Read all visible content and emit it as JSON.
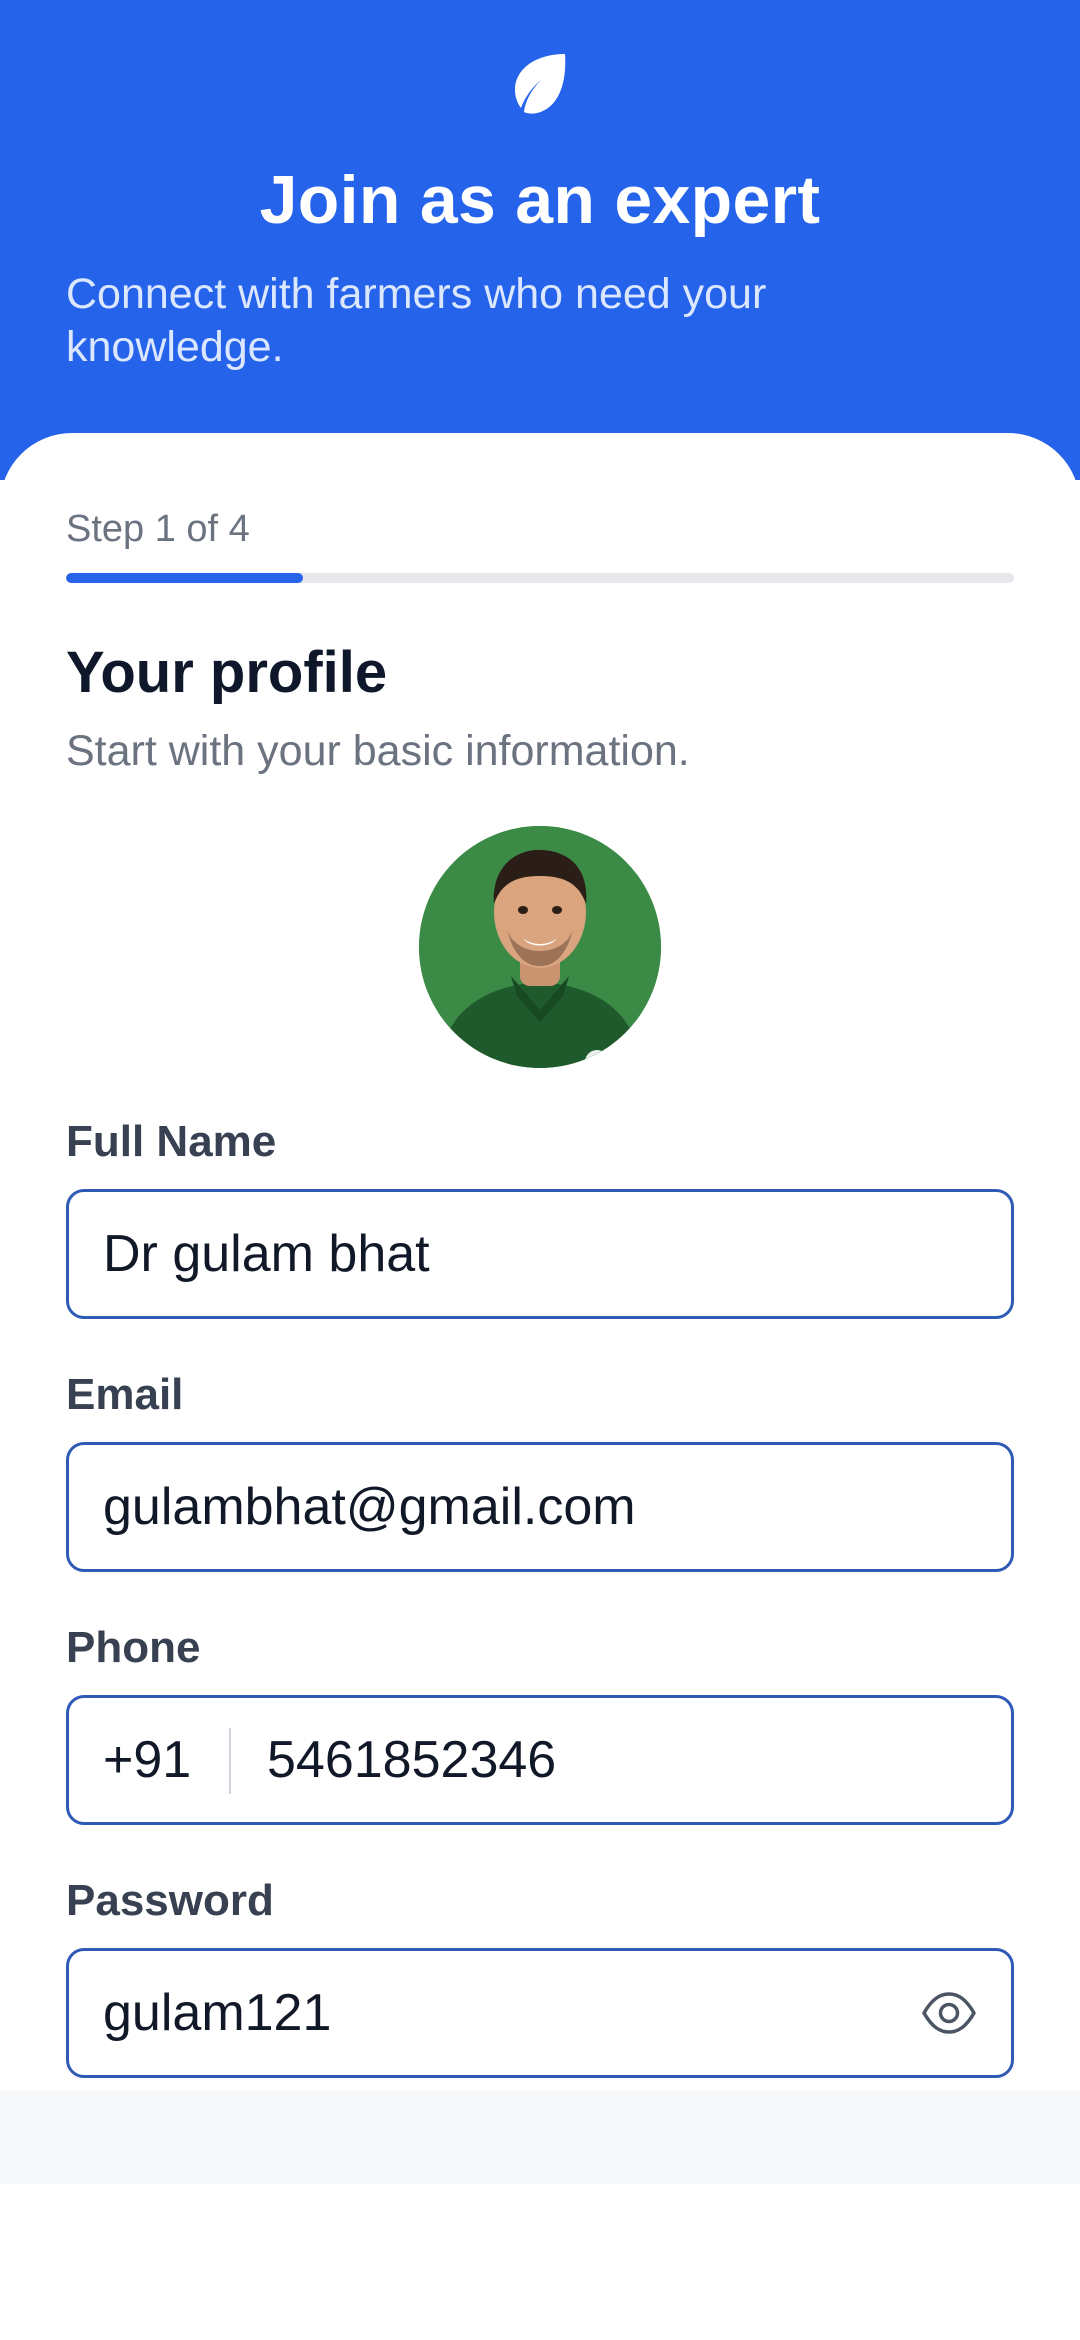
{
  "header": {
    "icon": "leaf-icon",
    "title": "Join as an expert",
    "subtitle": "Connect with farmers who need your knowledge."
  },
  "step": {
    "label": "Step 1 of 4",
    "current": 1,
    "total": 4,
    "progress_fraction": 0.25
  },
  "section": {
    "title": "Your profile",
    "subtitle": "Start with your basic information."
  },
  "form": {
    "full_name": {
      "label": "Full Name",
      "value": "Dr gulam bhat"
    },
    "email": {
      "label": "Email",
      "value": "gulambhat@gmail.com"
    },
    "phone": {
      "label": "Phone",
      "country_code": "+91",
      "value": "5461852346"
    },
    "password": {
      "label": "Password",
      "value": "gulam121",
      "toggle_icon": "eye-icon"
    }
  },
  "colors": {
    "brand": "#2563EB",
    "field_border": "#2F5BB7",
    "track": "#E5E7EB",
    "avatar_bg": "#3B8A46"
  }
}
